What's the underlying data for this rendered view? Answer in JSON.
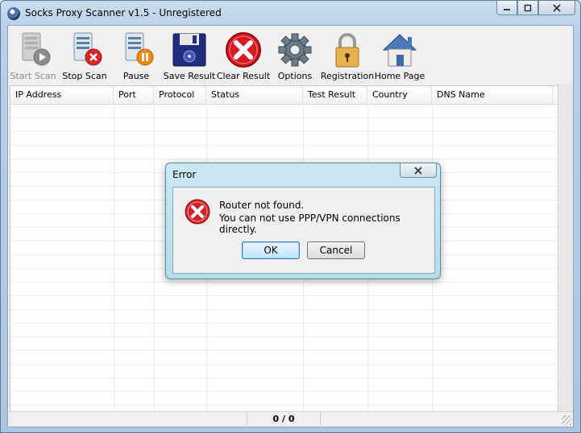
{
  "window": {
    "title": "Socks Proxy Scanner v1.5 - Unregistered"
  },
  "toolbar": {
    "items": [
      {
        "label": "Start Scan",
        "icon": "server-play-icon",
        "enabled": false
      },
      {
        "label": "Stop Scan",
        "icon": "server-stop-icon",
        "enabled": true
      },
      {
        "label": "Pause",
        "icon": "server-pause-icon",
        "enabled": true
      },
      {
        "label": "Save Result",
        "icon": "floppy-disk-icon",
        "enabled": true
      },
      {
        "label": "Clear Result",
        "icon": "red-x-icon",
        "enabled": true
      },
      {
        "label": "Options",
        "icon": "gear-icon",
        "enabled": true
      },
      {
        "label": "Registration",
        "icon": "padlock-icon",
        "enabled": true
      },
      {
        "label": "Home Page",
        "icon": "house-icon",
        "enabled": true
      }
    ]
  },
  "table": {
    "columns": [
      "IP Address",
      "Port",
      "Protocol",
      "Status",
      "Test Result",
      "Country",
      "DNS Name"
    ],
    "rows": []
  },
  "status": {
    "count": "0 / 0"
  },
  "dialog": {
    "title": "Error",
    "message_line1": "Router not found.",
    "message_line2": "You can not use PPP/VPN connections directly.",
    "ok_label": "OK",
    "cancel_label": "Cancel"
  }
}
